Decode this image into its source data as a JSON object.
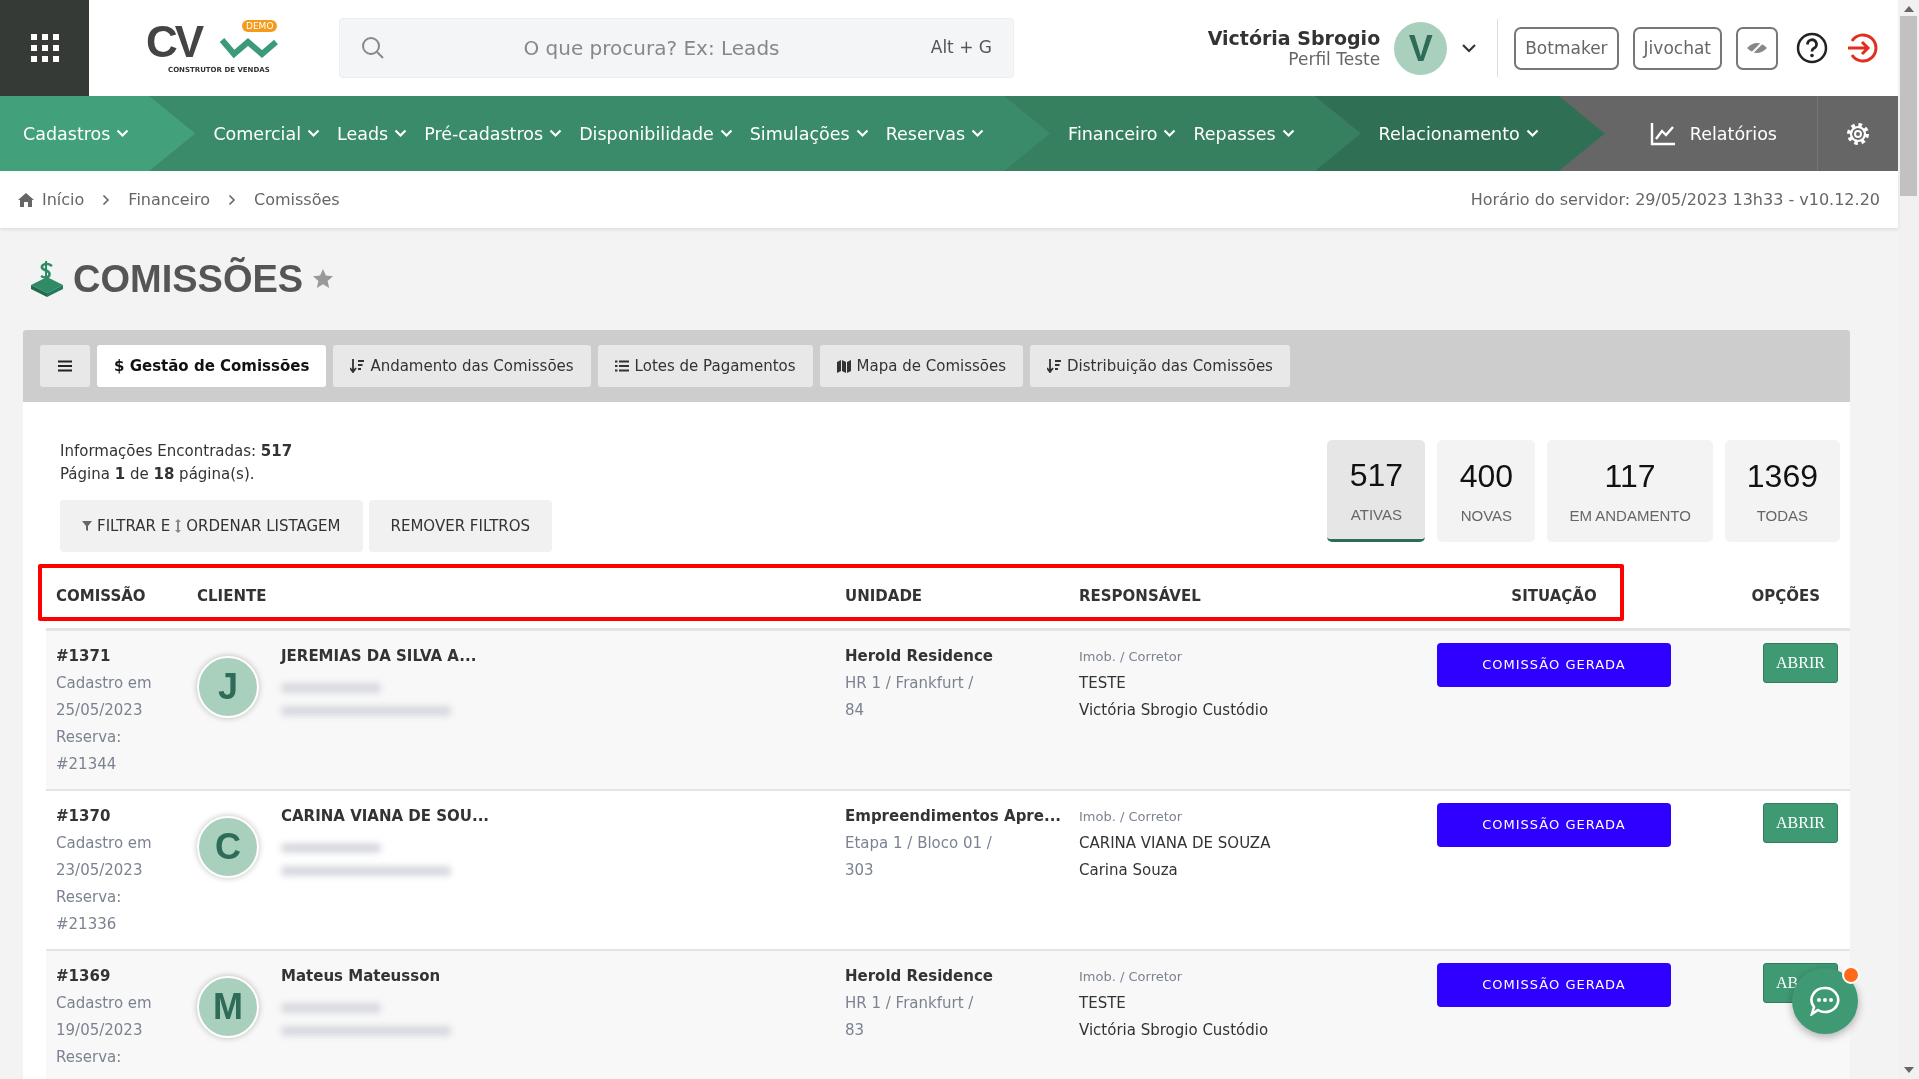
{
  "header": {
    "logo": {
      "mark": "CV",
      "badge": "DEMO",
      "tagline": "CONSTRUTOR DE VENDAS"
    },
    "search": {
      "placeholder": "O que procura? Ex: Leads",
      "shortcut": "Alt + G"
    },
    "user": {
      "name": "Victória Sbrogio",
      "profile": "Perfil Teste",
      "initial": "V"
    },
    "buttons": [
      "Botmaker",
      "Jivochat"
    ]
  },
  "nav": {
    "groups": [
      {
        "color": "#42a07a",
        "items": [
          "Cadastros"
        ]
      },
      {
        "color": "#3a8b69",
        "items": [
          "Comercial",
          "Leads",
          "Pré-cadastros",
          "Disponibilidade",
          "Simulações",
          "Reservas"
        ]
      },
      {
        "color": "#36805f",
        "items": [
          "Financeiro",
          "Repasses"
        ]
      },
      {
        "color": "#2f7055",
        "items": [
          "Relacionamento"
        ]
      }
    ],
    "reports": "Relatórios"
  },
  "breadcrumb": [
    "Início",
    "Financeiro",
    "Comissões"
  ],
  "server_time": "Horário do servidor: 29/05/2023 13h33 - v10.12.20",
  "page_title": "COMISSÕES",
  "tabs": [
    {
      "kind": "money",
      "label": "$ Gestão de Comissões",
      "selected": true
    },
    {
      "kind": "sort",
      "label": "Andamento das Comissões",
      "selected": false
    },
    {
      "kind": "list",
      "label": "Lotes de Pagamentos",
      "selected": false
    },
    {
      "kind": "map",
      "label": "Mapa de Comissões",
      "selected": false
    },
    {
      "kind": "sort",
      "label": "Distribuição das Comissões",
      "selected": false
    }
  ],
  "summary": [
    "Informações Encontradas: **517**",
    "Página **1** de **18** página(s)."
  ],
  "filter_button": {
    "label_1": "FILTRAR E",
    "label_2": "ORDENAR LISTAGEM"
  },
  "remove_filters": "REMOVER FILTROS",
  "counters": [
    {
      "value": "517",
      "label": "ATIVAS",
      "selected": true
    },
    {
      "value": "400",
      "label": "NOVAS",
      "selected": false
    },
    {
      "value": "117",
      "label": "EM ANDAMENTO",
      "selected": false
    },
    {
      "value": "1369",
      "label": "TODAS",
      "selected": false
    }
  ],
  "table": {
    "columns": [
      "COMISSÃO",
      "CLIENTE",
      "UNIDADE",
      "RESPONSÁVEL",
      "SITUAÇÃO",
      "OPÇÕES"
    ],
    "rows": [
      {
        "id": "#1371",
        "registered_label": "Cadastro em",
        "date": "25/05/2023",
        "reservation_label": "Reserva:",
        "reservation": "#21344",
        "initial": "J",
        "client": "JEREMIAS DA SILVA A...",
        "unit": "Herold Residence",
        "unit_detail": "HR 1 / Frankfurt /",
        "unit_number": "84",
        "role": "Imob. / Corretor",
        "agency": "TESTE",
        "agent": "Victória Sbrogio Custódio",
        "status": "COMISSÃO GERADA",
        "action": "ABRIR"
      },
      {
        "id": "#1370",
        "registered_label": "Cadastro em",
        "date": "23/05/2023",
        "reservation_label": "Reserva:",
        "reservation": "#21336",
        "initial": "C",
        "client": "CARINA VIANA DE SOU...",
        "unit": "Empreendimentos Apre...",
        "unit_detail": "Etapa 1 / Bloco 01 /",
        "unit_number": "303",
        "role": "Imob. / Corretor",
        "agency": "CARINA VIANA DE SOUZA",
        "agent": "Carina Souza",
        "status": "COMISSÃO GERADA",
        "action": "ABRIR"
      },
      {
        "id": "#1369",
        "registered_label": "Cadastro em",
        "date": "19/05/2023",
        "reservation_label": "Reserva:",
        "initial": "M",
        "client": "Mateus Mateusson",
        "unit": "Herold Residence",
        "unit_detail": "HR 1 / Frankfurt /",
        "unit_number": "83",
        "role": "Imob. / Corretor",
        "agency": "TESTE",
        "agent": "Victória Sbrogio Custódio",
        "status": "COMISSÃO GERADA",
        "action": "AB"
      }
    ]
  }
}
